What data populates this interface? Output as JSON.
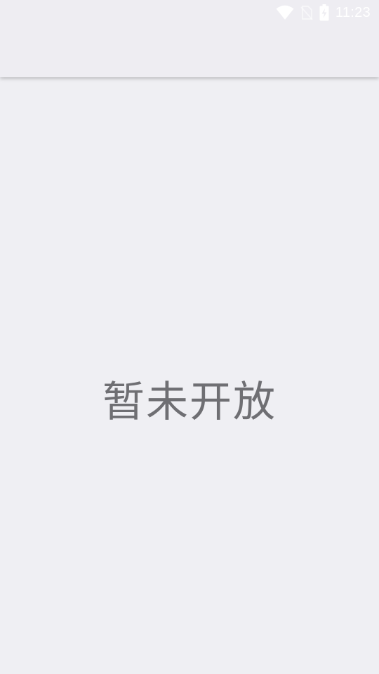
{
  "status_bar": {
    "time": "11:23",
    "icons": [
      "wifi-icon",
      "no-sim-icon",
      "battery-charging-icon"
    ]
  },
  "main": {
    "empty_message": "暂未开放"
  },
  "colors": {
    "background": "#efeff3",
    "app_bar": "#eeedf2",
    "message_text": "#6f6f73",
    "status_icons": "#ffffff"
  }
}
